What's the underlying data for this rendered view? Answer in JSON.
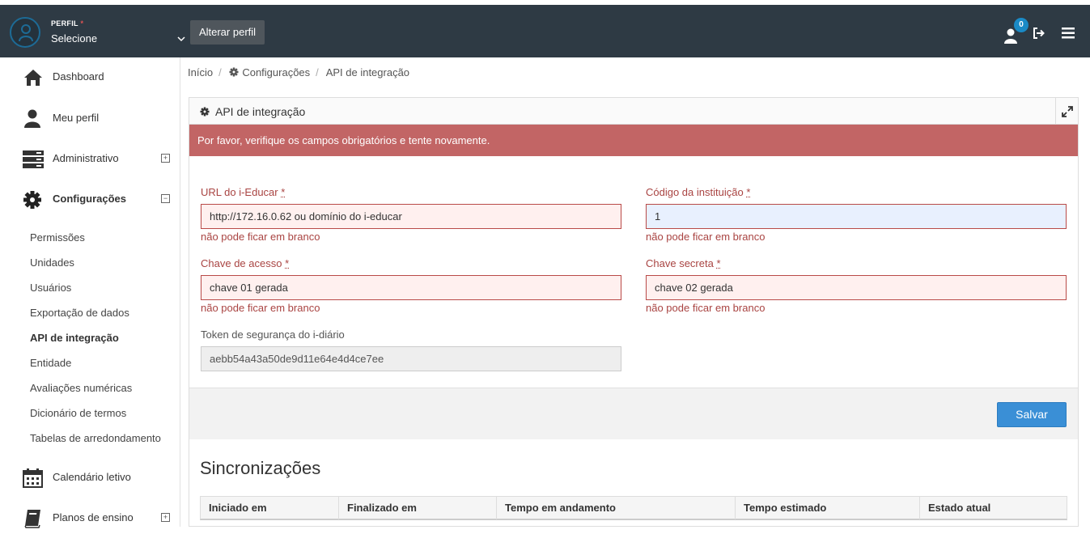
{
  "header": {
    "perfil_label": "PERFIL",
    "perfil_required": "*",
    "perfil_value": "Selecione",
    "alterar_button": "Alterar perfil",
    "notification_count": "0"
  },
  "sidebar": {
    "items": [
      {
        "label": "Dashboard",
        "icon": "home-icon"
      },
      {
        "label": "Meu perfil",
        "icon": "user-icon"
      },
      {
        "label": "Administrativo",
        "icon": "server-icon",
        "toggle": "+"
      },
      {
        "label": "Configurações",
        "icon": "gear-icon",
        "toggle": "−"
      }
    ],
    "sub_items": [
      "Permissões",
      "Unidades",
      "Usuários",
      "Exportação de dados",
      "API de integração",
      "Entidade",
      "Avaliações numéricas",
      "Dicionário de termos",
      "Tabelas de arredondamento"
    ],
    "bottom_items": [
      {
        "label": "Calendário letivo",
        "icon": "calendar-icon"
      },
      {
        "label": "Planos de ensino",
        "icon": "book-icon",
        "toggle": "+"
      }
    ]
  },
  "breadcrumb": {
    "home": "Início",
    "section": "Configurações",
    "current": "API de integração"
  },
  "panel": {
    "title": "API de integração",
    "alert": "Por favor, verifique os campos obrigatórios e tente novamente."
  },
  "form": {
    "url_label": "URL do i-Educar",
    "url_value": "http://172.16.0.62 ou domínio do i-educar",
    "url_error": "não pode ficar em branco",
    "codigo_label": "Código da instituição",
    "codigo_value": "1",
    "codigo_error": "não pode ficar em branco",
    "chave_acesso_label": "Chave de acesso",
    "chave_acesso_value": "chave 01 gerada",
    "chave_acesso_error": "não pode ficar em branco",
    "chave_secreta_label": "Chave secreta",
    "chave_secreta_value": "chave 02 gerada",
    "chave_secreta_error": "não pode ficar em branco",
    "token_label": "Token de segurança do i-diário",
    "token_value": "aebb54a43a50de9d11e64e4d4ce7ee",
    "required_mark": "*",
    "save_button": "Salvar"
  },
  "sync": {
    "title": "Sincronizações",
    "columns": [
      "Iniciado em",
      "Finalizado em",
      "Tempo em andamento",
      "Tempo estimado",
      "Estado atual"
    ]
  }
}
